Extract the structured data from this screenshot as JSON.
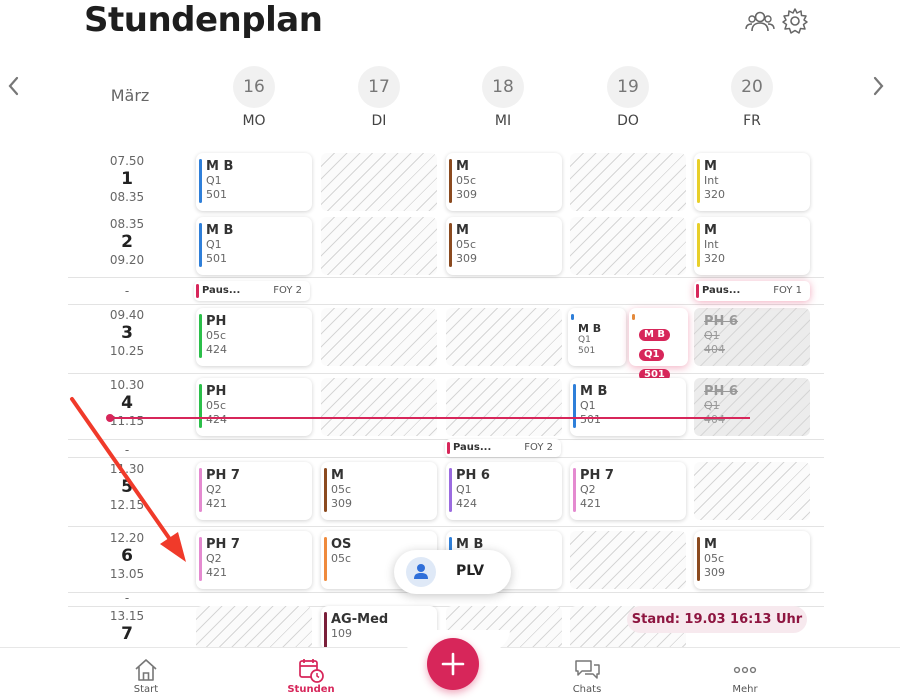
{
  "header": {
    "title": "Stundenplan",
    "icons": [
      "group-icon",
      "gear-icon"
    ]
  },
  "week": {
    "month": "März",
    "days": [
      {
        "num": "16",
        "name": "MO"
      },
      {
        "num": "17",
        "name": "DI"
      },
      {
        "num": "18",
        "name": "MI"
      },
      {
        "num": "19",
        "name": "DO"
      },
      {
        "num": "20",
        "name": "FR"
      }
    ]
  },
  "periods": [
    {
      "start": "07.50",
      "num": "1",
      "end": "08.35"
    },
    {
      "start": "08.35",
      "num": "2",
      "end": "09.20"
    },
    {
      "start": "09.40",
      "num": "3",
      "end": "10.25"
    },
    {
      "start": "10.30",
      "num": "4",
      "end": "11.15"
    },
    {
      "start": "11.30",
      "num": "5",
      "end": "12.15"
    },
    {
      "start": "12.20",
      "num": "6",
      "end": "13.05"
    },
    {
      "start": "13.15",
      "num": "7",
      "end": ""
    }
  ],
  "break_marker": "-",
  "lessons": [
    {
      "subject": "M B",
      "class": "Q1",
      "room": "501",
      "color": "#2f7fd9"
    },
    {
      "subject": "M",
      "class": "05c",
      "room": "309",
      "color": "#8b4a1f"
    },
    {
      "subject": "M",
      "class": "Int",
      "room": "320",
      "color": "#e8cf2a"
    },
    {
      "subject": "M B",
      "class": "Q1",
      "room": "501",
      "color": "#2f7fd9"
    },
    {
      "subject": "M",
      "class": "05c",
      "room": "309",
      "color": "#8b4a1f"
    },
    {
      "subject": "M",
      "class": "Int",
      "room": "320",
      "color": "#e8cf2a"
    },
    {
      "subject": "PH",
      "class": "05c",
      "room": "424",
      "color": "#2bbf4a"
    },
    {
      "subject": "M B",
      "class": "Q1",
      "room": "501",
      "color": "#2f7fd9"
    },
    {
      "subject": "M B",
      "class": "Q1",
      "room": "501",
      "color": "#d7265a"
    },
    {
      "subject": "PH 6",
      "class": "Q1",
      "room": "404",
      "color": "#999999"
    },
    {
      "subject": "PH",
      "class": "05c",
      "room": "424",
      "color": "#2bbf4a"
    },
    {
      "subject": "M B",
      "class": "Q1",
      "room": "501",
      "color": "#2f7fd9"
    },
    {
      "subject": "PH 6",
      "class": "Q1",
      "room": "404",
      "color": "#999999"
    },
    {
      "subject": "PH 7",
      "class": "Q2",
      "room": "421",
      "color": "#e48ad0"
    },
    {
      "subject": "M",
      "class": "05c",
      "room": "309",
      "color": "#8b4a1f"
    },
    {
      "subject": "PH 6",
      "class": "Q1",
      "room": "424",
      "color": "#9b6be0"
    },
    {
      "subject": "PH 7",
      "class": "Q2",
      "room": "421",
      "color": "#e48ad0"
    },
    {
      "subject": "PH 7",
      "class": "Q2",
      "room": "421",
      "color": "#e48ad0"
    },
    {
      "subject": "OS",
      "class": "05c",
      "room": "",
      "color": "#ef8a3c"
    },
    {
      "subject": "M B",
      "class": "",
      "room": "",
      "color": "#2f7fd9"
    },
    {
      "subject": "M",
      "class": "05c",
      "room": "309",
      "color": "#8b4a1f"
    },
    {
      "subject": "AG-Med",
      "class": "109",
      "room": "",
      "color": "#7a1f3a"
    }
  ],
  "pauses": [
    {
      "label": "Paus...",
      "room": "FOY 2"
    },
    {
      "label": "Paus...",
      "room": "FOY 1"
    },
    {
      "label": "Paus...",
      "room": "FOY 2"
    }
  ],
  "plv": {
    "label": "PLV"
  },
  "status": {
    "text": "Stand: 19.03 16:13 Uhr"
  },
  "nav": [
    {
      "label": "Start"
    },
    {
      "label": "Stunden"
    },
    {
      "label": "Chats"
    },
    {
      "label": "Mehr"
    }
  ],
  "colors": {
    "accent": "#d7265a"
  }
}
